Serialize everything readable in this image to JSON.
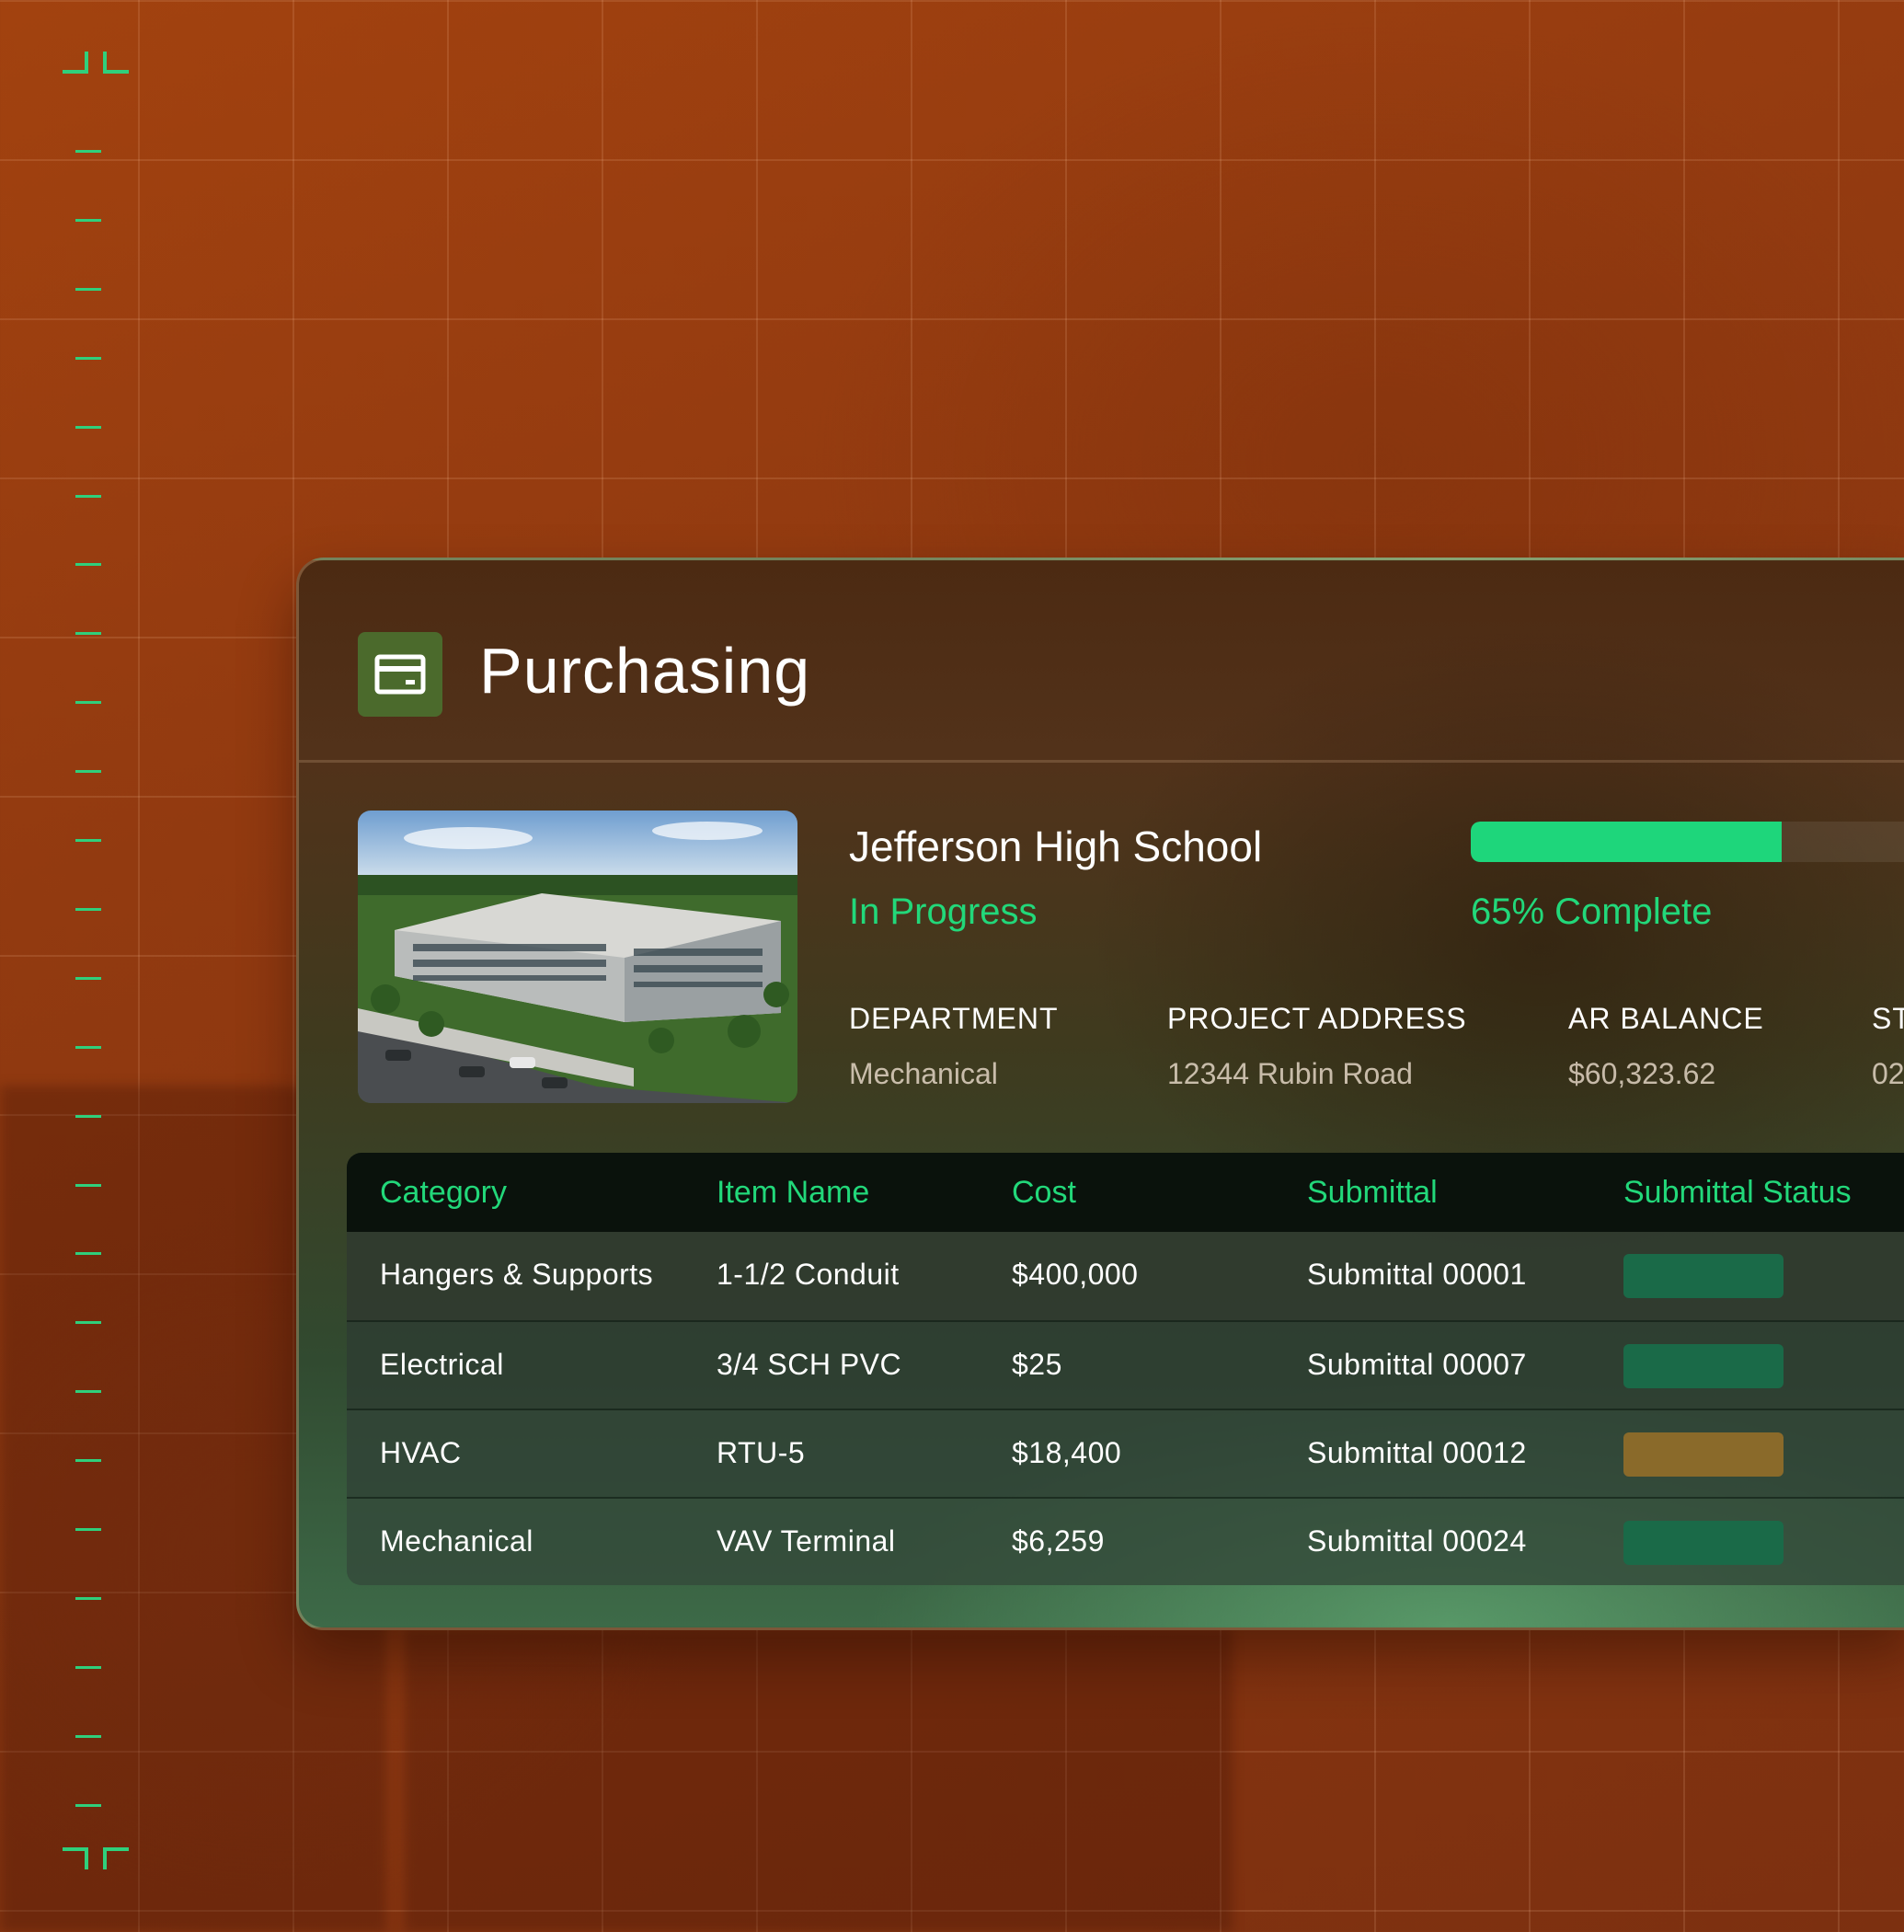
{
  "page": {
    "title": "Purchasing",
    "icon": "card-icon"
  },
  "project": {
    "name": "Jefferson High School",
    "status": "In Progress",
    "progress_fraction": 0.65,
    "progress_label": "65% Complete",
    "image": "building-thumbnail"
  },
  "meta": [
    {
      "label": "DEPARTMENT",
      "value": "Mechanical"
    },
    {
      "label": "PROJECT ADDRESS",
      "value": "12344 Rubin Road"
    },
    {
      "label": "AR BALANCE",
      "value": "$60,323.62"
    },
    {
      "label": "ST",
      "value": "02"
    }
  ],
  "table": {
    "headers": [
      "Category",
      "Item Name",
      "Cost",
      "Submittal",
      "Submittal Status"
    ],
    "rows": [
      {
        "category": "Hangers & Supports",
        "item": "1-1/2 Conduit",
        "cost": "$400,000",
        "submittal": "Submittal 00001",
        "status_color": "#1a6a48"
      },
      {
        "category": "Electrical",
        "item": "3/4 SCH PVC",
        "cost": "$25",
        "submittal": "Submittal 00007",
        "status_color": "#1a6a48"
      },
      {
        "category": "HVAC",
        "item": "RTU-5",
        "cost": "$18,400",
        "submittal": "Submittal 00012",
        "status_color": "#8a6a2a"
      },
      {
        "category": "Mechanical",
        "item": "VAV Terminal",
        "cost": "$6,259",
        "submittal": "Submittal 00024",
        "status_color": "#1a6a48"
      }
    ]
  },
  "colors": {
    "accent": "#22d87a",
    "background": "#923a10"
  }
}
